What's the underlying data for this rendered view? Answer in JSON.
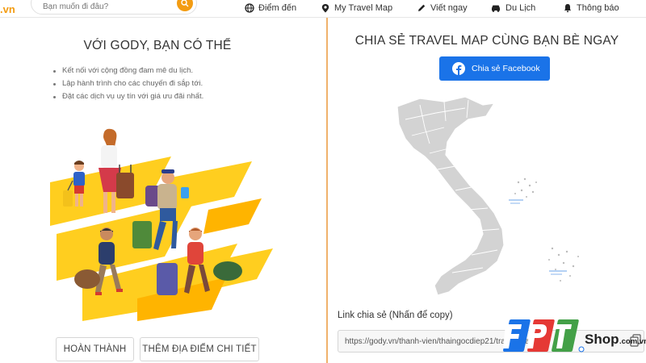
{
  "nav": {
    "brand_fragment": ".vn",
    "search_placeholder": "Bạn muốn đi đâu?",
    "items": [
      {
        "label": "Điểm đến",
        "icon": "globe-icon"
      },
      {
        "label": "My Travel Map",
        "icon": "map-pin-icon"
      },
      {
        "label": "Viết ngay",
        "icon": "pen-icon"
      },
      {
        "label": "Du Lịch",
        "icon": "car-icon"
      },
      {
        "label": "Thông báo",
        "icon": "bell-icon"
      }
    ]
  },
  "left": {
    "title": "VỚI GODY, BẠN CÓ THỂ",
    "benefits": [
      "Kết nối với cộng đồng đam mê du lịch.",
      "Lập hành trình cho các chuyến đi sắp tới.",
      "Đặt các dịch vụ uy tín với giá ưu đãi nhất."
    ],
    "buttons": {
      "done": "HOÀN THÀNH",
      "add_place": "THÊM ĐỊA ĐIỂM CHI TIẾT"
    }
  },
  "right": {
    "title": "CHIA SẺ TRAVEL MAP CÙNG BẠN BÈ NGAY",
    "facebook_button": "Chia sẻ Facebook",
    "link_label": "Link chia sẻ (Nhấn để copy)",
    "link_value": "https://gody.vn/thanh-vien/thaingocdiep21/travel-map-do"
  },
  "watermark": {
    "text": "FPT Shop.com.vn"
  },
  "colors": {
    "accent": "#f39c12",
    "facebook_blue": "#1a73e8",
    "divider": "#f0b26b",
    "map_gray": "#d3d3d3"
  }
}
